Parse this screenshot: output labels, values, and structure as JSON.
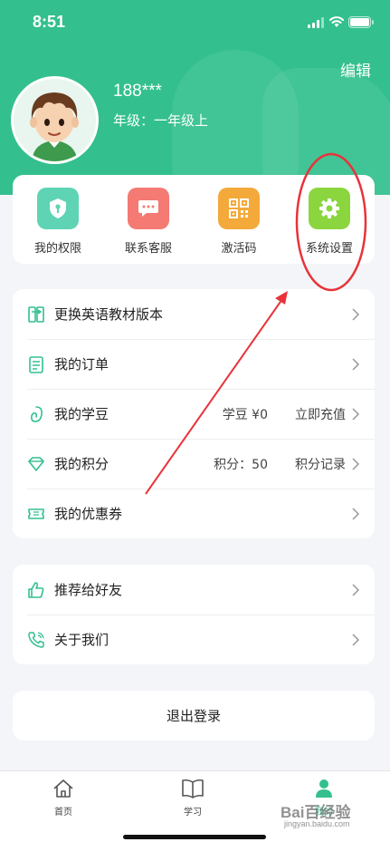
{
  "status_bar": {
    "time": "8:51"
  },
  "profile": {
    "edit_label": "编辑",
    "username": "188***",
    "grade": "年级：一年级上"
  },
  "quick_actions": [
    {
      "label": "我的权限",
      "icon": "shield-key-icon",
      "color": "#5fd4b4"
    },
    {
      "label": "联系客服",
      "icon": "chat-bubble-icon",
      "color": "#f47a73"
    },
    {
      "label": "激活码",
      "icon": "qr-code-icon",
      "color": "#f4a93b"
    },
    {
      "label": "系统设置",
      "icon": "gear-icon",
      "color": "#8bd63f"
    }
  ],
  "menu_group_1": [
    {
      "label": "更换英语教材版本",
      "icon": "swap-book-icon"
    },
    {
      "label": "我的订单",
      "icon": "order-list-icon"
    },
    {
      "label": "我的学豆",
      "icon": "bean-icon",
      "value": "学豆 ¥0",
      "action": "立即充值"
    },
    {
      "label": "我的积分",
      "icon": "diamond-icon",
      "value": "积分：50",
      "action": "积分记录"
    },
    {
      "label": "我的优惠券",
      "icon": "coupon-icon"
    }
  ],
  "menu_group_2": [
    {
      "label": "推荐给好友",
      "icon": "thumbs-up-icon"
    },
    {
      "label": "关于我们",
      "icon": "phone-icon"
    }
  ],
  "logout_label": "退出登录",
  "tabbar": [
    {
      "label": "首页",
      "icon": "home-icon"
    },
    {
      "label": "学习",
      "icon": "book-icon"
    },
    {
      "label": "我的",
      "icon": "person-icon",
      "active": true
    }
  ],
  "watermark": {
    "top": "Bai百经验",
    "bottom": "jingyan.baidu.com"
  },
  "colors": {
    "brand": "#33c08e",
    "annotation": "#e8333a"
  }
}
